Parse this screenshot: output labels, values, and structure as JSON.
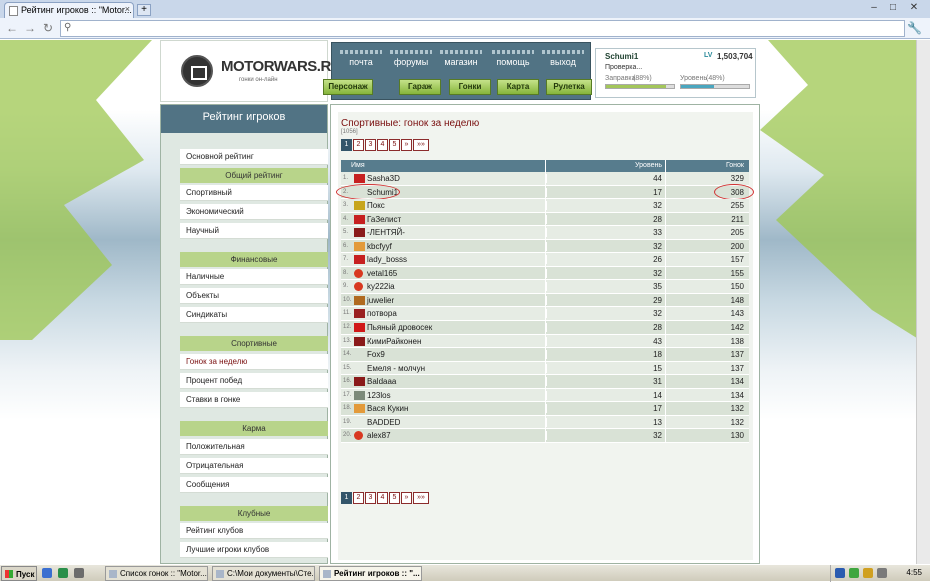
{
  "browser": {
    "tab_title": "Рейтинг игроков :: \"Motor...",
    "tab_close": "×",
    "new_tab": "+",
    "minimize": "–",
    "maximize": "□",
    "close": "✕",
    "back": "←",
    "forward": "→",
    "reload": "↻",
    "url": ""
  },
  "logo": {
    "text": "MOTORWARS.RU",
    "subtitle": "гонки он-лайн"
  },
  "nav": {
    "top": [
      "почта",
      "форумы",
      "магазин",
      "помощь",
      "выход"
    ],
    "buttons": [
      "Персонаж",
      "Гараж",
      "Гонки",
      "Карта",
      "Рулетка"
    ]
  },
  "profile": {
    "name": "Schumi1",
    "level_label": "LV",
    "level_value": "1,503,704",
    "status": "Проверка...",
    "fuel_label": "Заправка",
    "fuel_pct_text": "(88%)",
    "fuel_pct": 88,
    "level_bar_label": "Уровень",
    "level_pct_text": "(48%)",
    "level_pct": 48
  },
  "sidebar": {
    "title": "Рейтинг игроков",
    "main_item": "Основной рейтинг",
    "sections": [
      {
        "title": "Общий рейтинг",
        "items": [
          "Спортивный",
          "Экономический",
          "Научный"
        ]
      },
      {
        "title": "Финансовые",
        "items": [
          "Наличные",
          "Объекты",
          "Синдикаты"
        ]
      },
      {
        "title": "Спортивные",
        "items": [
          "Гонок за неделю",
          "Процент побед",
          "Ставки в гонке"
        ]
      },
      {
        "title": "Карма",
        "items": [
          "Положительная",
          "Отрицательная",
          "Сообщения"
        ]
      },
      {
        "title": "Клубные",
        "items": [
          "Рейтинг клубов",
          "Лучшие игроки клубов"
        ]
      }
    ]
  },
  "main": {
    "title": "Спортивные: гонок за неделю",
    "count": "[1056]",
    "pager": [
      "1",
      "2",
      "3",
      "4",
      "5",
      "»",
      "»»"
    ],
    "columns": [
      "Имя",
      "Уровень",
      "Гонок"
    ],
    "rows": [
      {
        "rank": "1.",
        "name": "Sasha3D",
        "level": "44",
        "races": "329",
        "icon": "sickle-icon",
        "color": "#c62020"
      },
      {
        "rank": "2.",
        "name": "Schumi1",
        "level": "17",
        "races": "308",
        "icon": "",
        "color": ""
      },
      {
        "rank": "3.",
        "name": "Покс",
        "level": "32",
        "races": "255",
        "icon": "flag-icon",
        "color": "#c7a51c"
      },
      {
        "rank": "4.",
        "name": "ГаЗелист",
        "level": "28",
        "races": "211",
        "icon": "flag-icon",
        "color": "#c62020"
      },
      {
        "rank": "5.",
        "name": "-ЛЕНТЯЙ-",
        "level": "33",
        "races": "205",
        "icon": "club-icon",
        "color": "#8a1a1a"
      },
      {
        "rank": "6.",
        "name": "kbcfyyf",
        "level": "32",
        "races": "200",
        "icon": "club-icon",
        "color": "#e39a3a"
      },
      {
        "rank": "7.",
        "name": "lady_bosss",
        "level": "26",
        "races": "157",
        "icon": "plane-icon",
        "color": "#c62020"
      },
      {
        "rank": "8.",
        "name": "vetal165",
        "level": "32",
        "races": "155",
        "icon": "tomato-icon",
        "color": "#d83820"
      },
      {
        "rank": "9.",
        "name": "ky222ia",
        "level": "35",
        "races": "150",
        "icon": "tomato-icon",
        "color": "#d83820"
      },
      {
        "rank": "10.",
        "name": "juwelier",
        "level": "29",
        "races": "148",
        "icon": "club-icon",
        "color": "#b06a20"
      },
      {
        "rank": "11.",
        "name": "потвора",
        "level": "32",
        "races": "143",
        "icon": "club-icon",
        "color": "#9a2020"
      },
      {
        "rank": "12.",
        "name": "Пьяный дровосек",
        "level": "28",
        "races": "142",
        "icon": "heart-icon",
        "color": "#d01818"
      },
      {
        "rank": "13.",
        "name": "КимиРайконен",
        "level": "43",
        "races": "138",
        "icon": "club-icon",
        "color": "#8a1a1a"
      },
      {
        "rank": "14.",
        "name": "Fox9",
        "level": "18",
        "races": "137",
        "icon": "",
        "color": ""
      },
      {
        "rank": "15.",
        "name": "Емеля - молчун",
        "level": "15",
        "races": "137",
        "icon": "",
        "color": ""
      },
      {
        "rank": "16.",
        "name": "Baldaaa",
        "level": "31",
        "races": "134",
        "icon": "club-icon",
        "color": "#8a1a1a"
      },
      {
        "rank": "17.",
        "name": "123los",
        "level": "14",
        "races": "134",
        "icon": "club-icon",
        "color": "#7c8a7a"
      },
      {
        "rank": "18.",
        "name": "Вася Кукин",
        "level": "17",
        "races": "132",
        "icon": "club-icon",
        "color": "#e39a3a"
      },
      {
        "rank": "19.",
        "name": "BADDED",
        "level": "13",
        "races": "132",
        "icon": "",
        "color": ""
      },
      {
        "rank": "20.",
        "name": "alex87",
        "level": "32",
        "races": "130",
        "icon": "tomato-icon",
        "color": "#d83820"
      }
    ]
  },
  "taskbar": {
    "start": "Пуск",
    "tasks": [
      "Список гонок :: \"Motor...",
      "C:\\Мои документы\\Сте...",
      "Рейтинг игроков :: \"..."
    ],
    "clock": "4:55"
  },
  "colors": {
    "accent": "#517384",
    "green": "#9dc750",
    "link": "#7a0f0f"
  }
}
